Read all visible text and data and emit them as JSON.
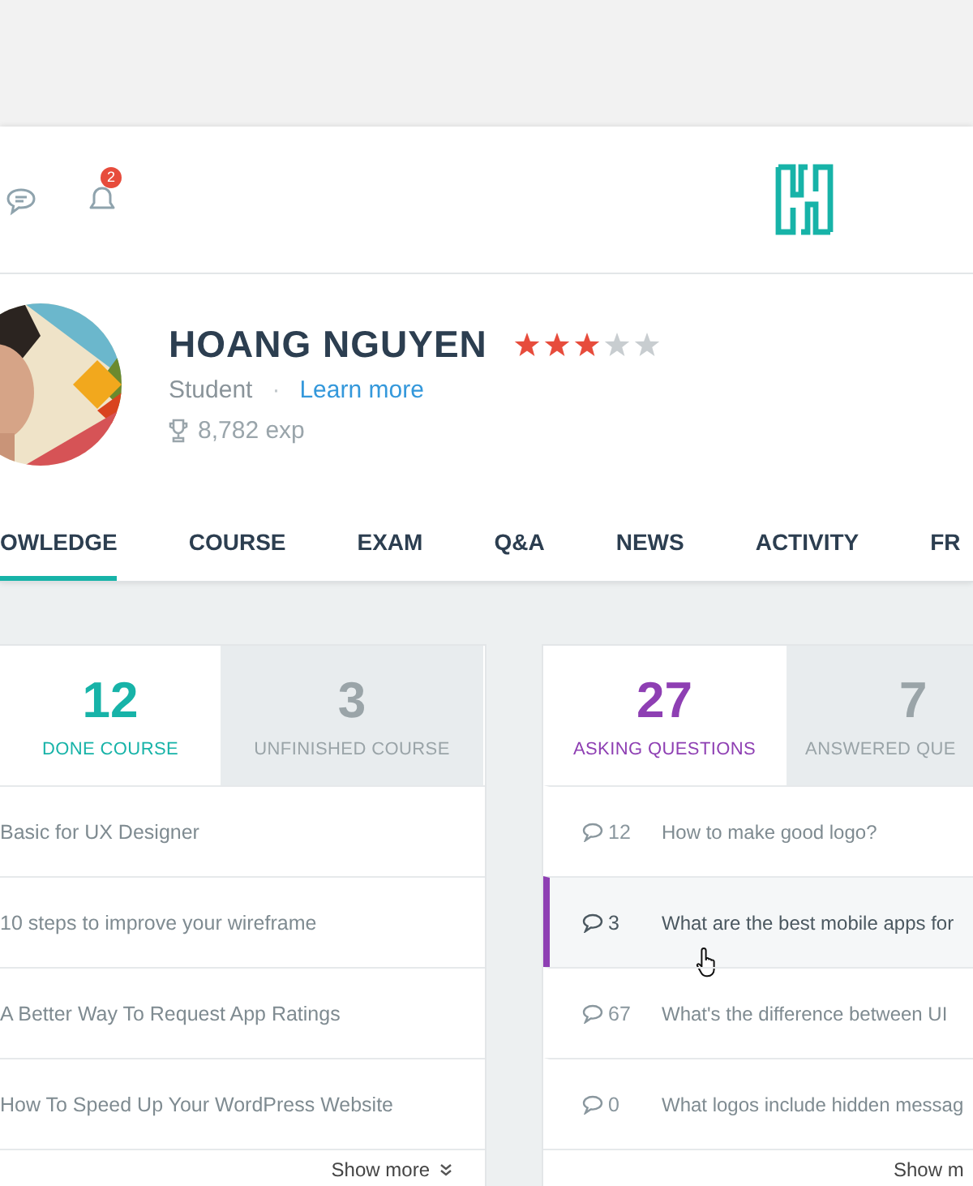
{
  "header": {
    "notification_count": "2"
  },
  "profile": {
    "name": "HOANG NGUYEN",
    "stars": 3,
    "role": "Student",
    "separator": "·",
    "link": "Learn more",
    "exp": "8,782 exp"
  },
  "nav_tabs": [
    {
      "label": "OWLEDGE",
      "selected": true
    },
    {
      "label": "COURSE",
      "selected": false
    },
    {
      "label": "EXAM",
      "selected": false
    },
    {
      "label": "Q&A",
      "selected": false
    },
    {
      "label": "NEWS",
      "selected": false
    },
    {
      "label": "ACTIVITY",
      "selected": false
    },
    {
      "label": "FR",
      "selected": false
    }
  ],
  "panels": [
    {
      "tabs": [
        {
          "count": "12",
          "label": "DONE COURSE",
          "selected": true
        },
        {
          "count": "3",
          "label": "UNFINISHED COURSE",
          "selected": false
        }
      ],
      "items": [
        {
          "title": "Basic for UX Designer",
          "selected": false
        },
        {
          "title": "10 steps to improve your wireframe",
          "selected": false
        },
        {
          "title": "A Better Way To Request App Ratings",
          "selected": false
        },
        {
          "title": "How To Speed Up Your WordPress Website",
          "selected": false
        }
      ],
      "show_more": "Show more"
    },
    {
      "tabs": [
        {
          "count": "27",
          "label": "ASKING QUESTIONS",
          "selected": true
        },
        {
          "count": "7",
          "label": "ANSWERED QUE",
          "selected": false
        }
      ],
      "items": [
        {
          "replies": "12",
          "title": "How to make good logo?",
          "selected": false
        },
        {
          "replies": "3",
          "title": "What are the best mobile apps for",
          "selected": true
        },
        {
          "replies": "67",
          "title": "What's the difference between UI",
          "selected": false
        },
        {
          "replies": "0",
          "title": "What logos include hidden messag",
          "selected": false
        }
      ],
      "show_more": "Show m"
    }
  ]
}
